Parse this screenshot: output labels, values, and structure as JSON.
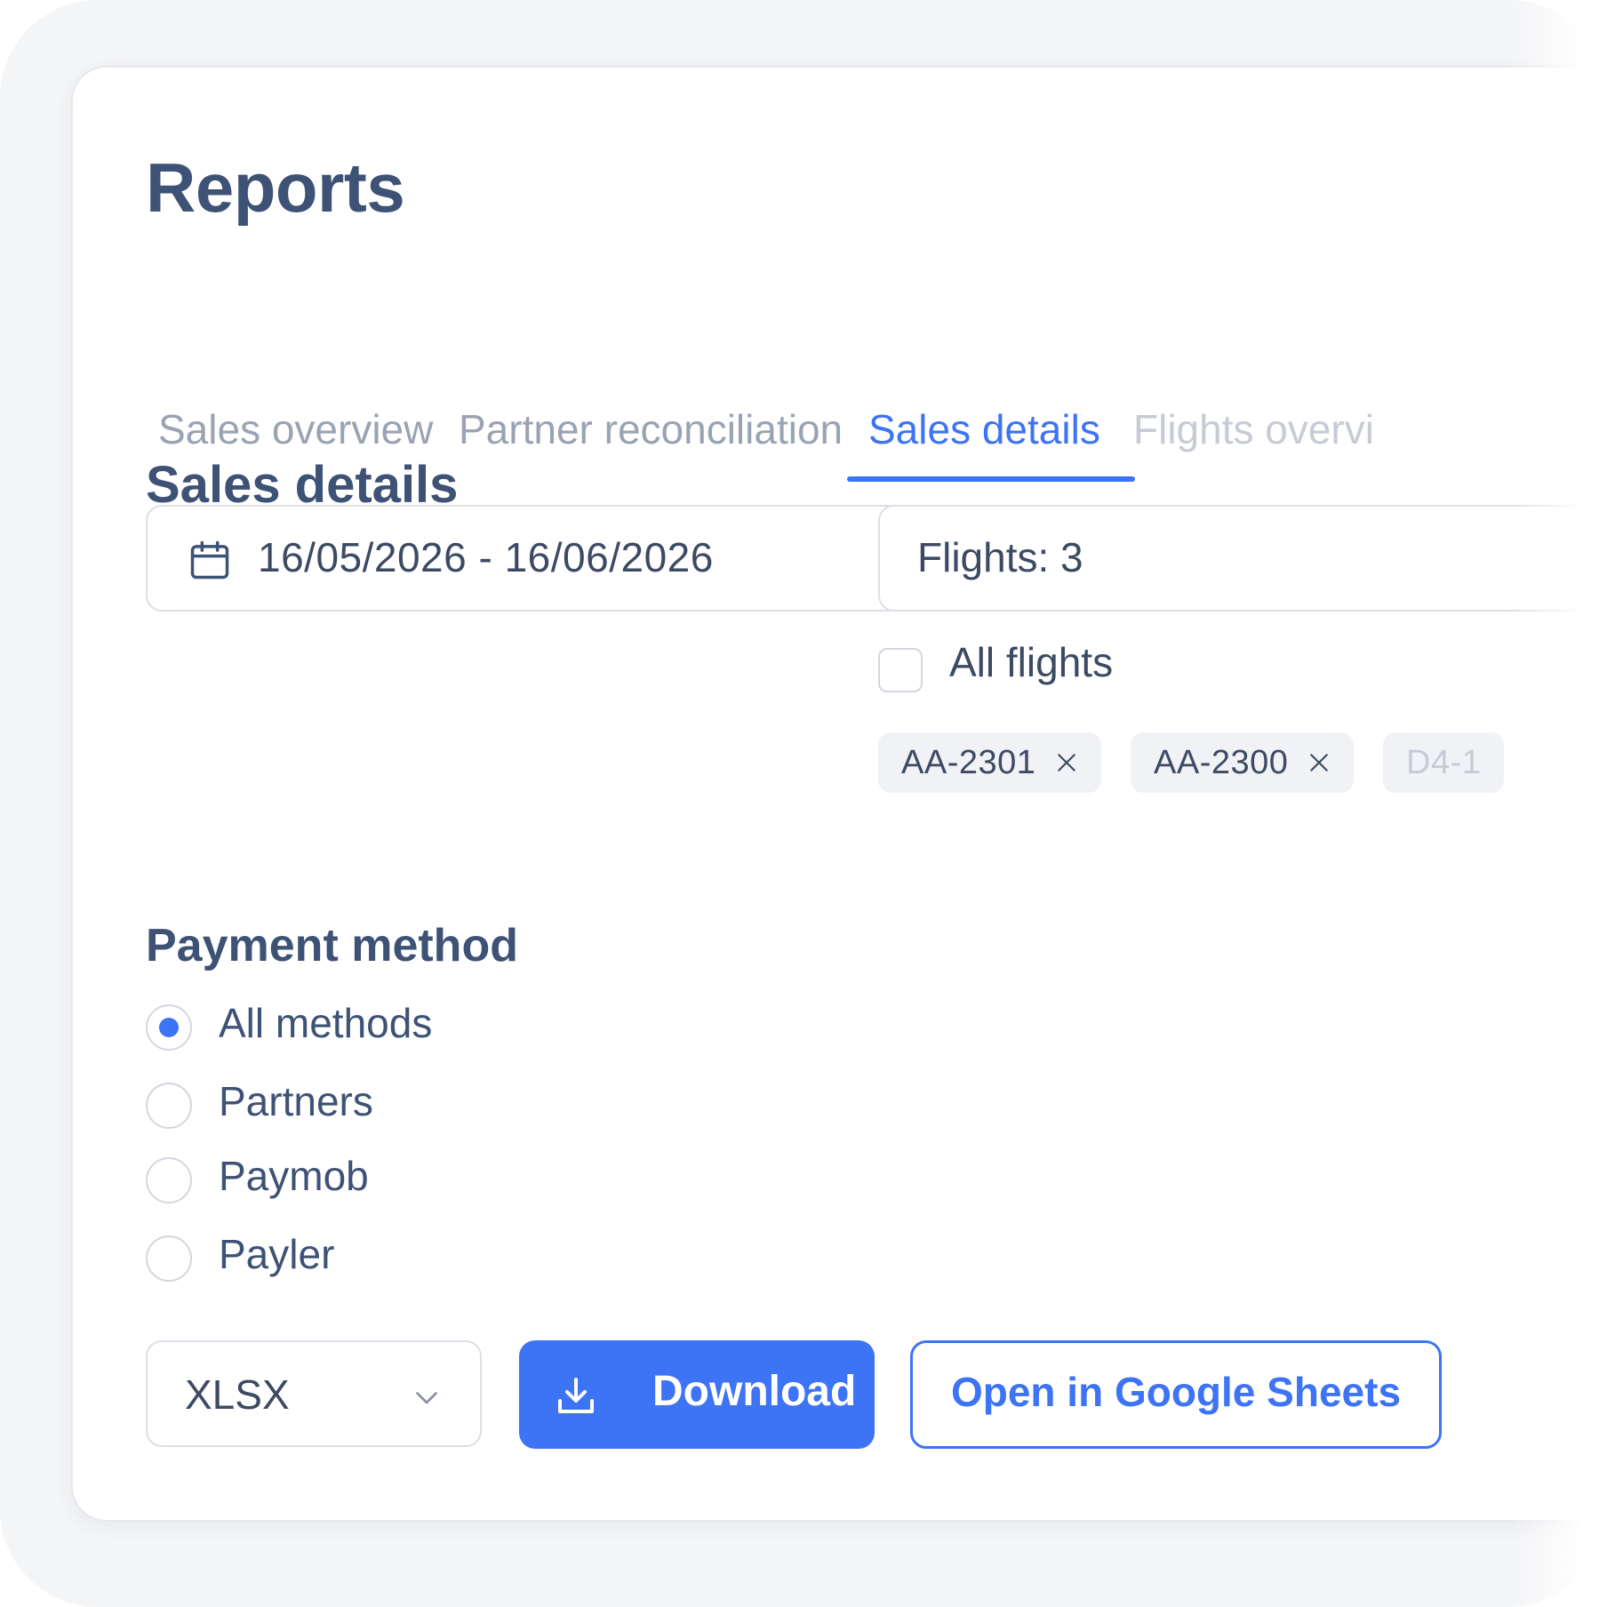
{
  "page": {
    "title": "Reports"
  },
  "tabs": [
    {
      "label": "Sales overview",
      "active": false
    },
    {
      "label": "Partner reconciliation",
      "active": false
    },
    {
      "label": "Sales details",
      "active": true
    },
    {
      "label": "Flights overvi",
      "active": false
    }
  ],
  "section": {
    "title": "Sales details"
  },
  "filters": {
    "date_range": "16/05/2026 - 16/06/2026",
    "flights_summary": "Flights: 3",
    "all_flights_label": "All flights",
    "all_flights_checked": false,
    "chips": [
      {
        "label": "AA-2301"
      },
      {
        "label": "AA-2300"
      },
      {
        "label": "D4-1"
      }
    ]
  },
  "payment_method": {
    "title": "Payment method",
    "options": [
      {
        "label": "All methods",
        "selected": true
      },
      {
        "label": "Partners",
        "selected": false
      },
      {
        "label": "Paymob",
        "selected": false
      },
      {
        "label": "Payler",
        "selected": false
      }
    ]
  },
  "export": {
    "format": "XLSX",
    "download_label": "Download",
    "gsheets_label": "Open in Google Sheets"
  },
  "colors": {
    "accent": "#3d73f5",
    "heading": "#3e5276",
    "text": "#3c4a63",
    "muted": "#9aa3b2"
  },
  "icons": [
    "calendar-icon",
    "close-icon",
    "chevron-down-icon",
    "download-icon"
  ]
}
